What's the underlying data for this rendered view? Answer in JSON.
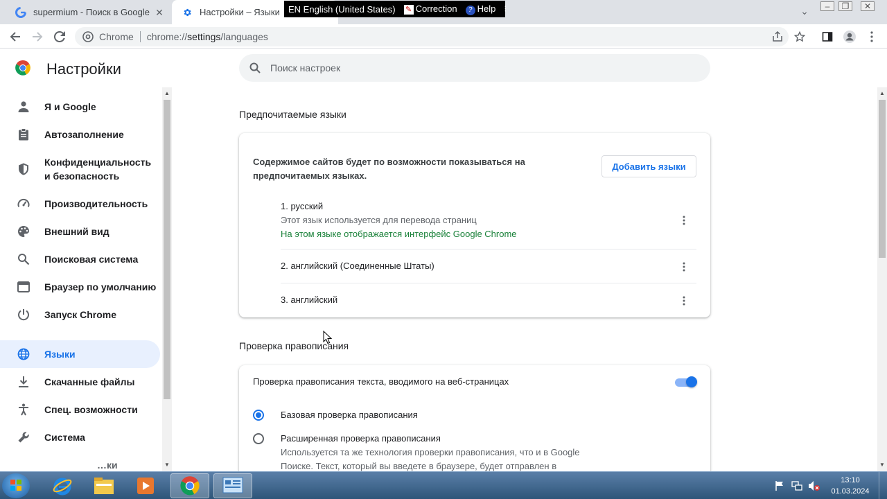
{
  "tabs": [
    {
      "title": "supermium - Поиск в Google",
      "icon": "google-icon"
    },
    {
      "title": "Настройки – Языки",
      "icon": "gear-icon"
    }
  ],
  "language_bar": {
    "lang": "EN English (United States)",
    "correction": "Correction",
    "help": "Help"
  },
  "omnibox": {
    "chip": "Chrome",
    "url_scheme": "chrome://",
    "url_host": "settings",
    "url_path": "/languages"
  },
  "header": {
    "title": "Настройки",
    "search_placeholder": "Поиск настроек"
  },
  "sidebar": {
    "items": [
      {
        "label": "Я и Google",
        "icon": "person-icon"
      },
      {
        "label": "Автозаполнение",
        "icon": "clipboard-icon"
      },
      {
        "label": "Конфиденциальность и безопасность",
        "icon": "shield-icon"
      },
      {
        "label": "Производительность",
        "icon": "speedometer-icon"
      },
      {
        "label": "Внешний вид",
        "icon": "palette-icon"
      },
      {
        "label": "Поисковая система",
        "icon": "search-icon"
      },
      {
        "label": "Браузер по умолчанию",
        "icon": "browser-icon"
      },
      {
        "label": "Запуск Chrome",
        "icon": "power-icon"
      },
      {
        "label": "Языки",
        "icon": "globe-icon",
        "active": true
      },
      {
        "label": "Скачанные файлы",
        "icon": "download-icon"
      },
      {
        "label": "Спец. возможности",
        "icon": "accessibility-icon"
      },
      {
        "label": "Система",
        "icon": "wrench-icon"
      },
      {
        "label": "…ки",
        "icon": ""
      }
    ]
  },
  "languages": {
    "section_title": "Предпочитаемые языки",
    "description": "Содержимое сайтов будет по возможности показываться на предпочитаемых языках.",
    "add_button": "Добавить языки",
    "items": [
      {
        "name": "1. русский",
        "note": "Этот язык используется для перевода страниц",
        "ui_note": "На этом языке отображается интерфейс Google Chrome"
      },
      {
        "name": "2. английский (Соединенные Штаты)"
      },
      {
        "name": "3. английский"
      }
    ]
  },
  "spellcheck": {
    "section_title": "Проверка правописания",
    "toggle_label": "Проверка правописания текста, вводимого на веб-страницах",
    "toggle_on": true,
    "basic_label": "Базовая проверка правописания",
    "enhanced_label": "Расширенная проверка правописания",
    "enhanced_desc_1": "Используется та же технология проверки правописания, что и в Google",
    "enhanced_desc_2": "Поиске. Текст, который вы введете в браузере, будет отправлен в",
    "selected": "basic"
  },
  "taskbar": {
    "time": "13:10",
    "date": "01.03.2024"
  },
  "colors": {
    "accent": "#1a73e8",
    "active_nav_bg": "#e8f0fe",
    "ui_language_note": "#188038"
  }
}
